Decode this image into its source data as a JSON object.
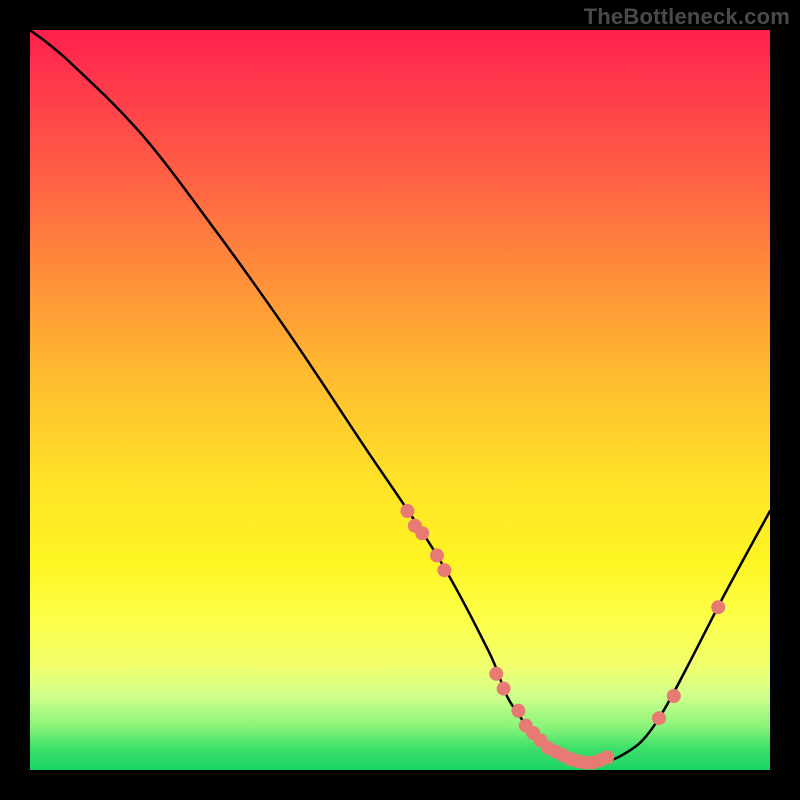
{
  "attribution": "TheBottleneck.com",
  "chart_data": {
    "type": "line",
    "title": "",
    "xlabel": "",
    "ylabel": "",
    "xlim": [
      0,
      100
    ],
    "ylim": [
      0,
      100
    ],
    "grid": false,
    "series": [
      {
        "name": "bottleneck-curve",
        "x": [
          0,
          5,
          15,
          25,
          35,
          45,
          55,
          62,
          65,
          70,
          75,
          80,
          85,
          94,
          100
        ],
        "y": [
          100,
          96,
          86,
          73,
          59,
          44,
          29,
          16,
          9,
          3,
          1,
          2,
          7,
          24,
          35
        ]
      }
    ],
    "markers": {
      "name": "highlighted-points",
      "color": "#e77b74",
      "x": [
        51,
        52,
        53,
        55,
        56,
        63,
        64,
        66,
        67,
        68,
        69,
        70,
        71,
        72,
        73,
        74,
        75,
        76,
        77,
        78,
        85,
        87,
        93
      ],
      "y": [
        35,
        33,
        32,
        29,
        27,
        13,
        11,
        8,
        6,
        5,
        4,
        3,
        2.5,
        2,
        1.5,
        1.2,
        1,
        1,
        1.3,
        1.7,
        7,
        10,
        22
      ]
    },
    "background": {
      "type": "vertical-gradient",
      "stops": [
        {
          "pos": 0,
          "color": "#ff1f4d"
        },
        {
          "pos": 50,
          "color": "#ffd52a"
        },
        {
          "pos": 85,
          "color": "#f5ff60"
        },
        {
          "pos": 100,
          "color": "#1ad463"
        }
      ]
    }
  }
}
